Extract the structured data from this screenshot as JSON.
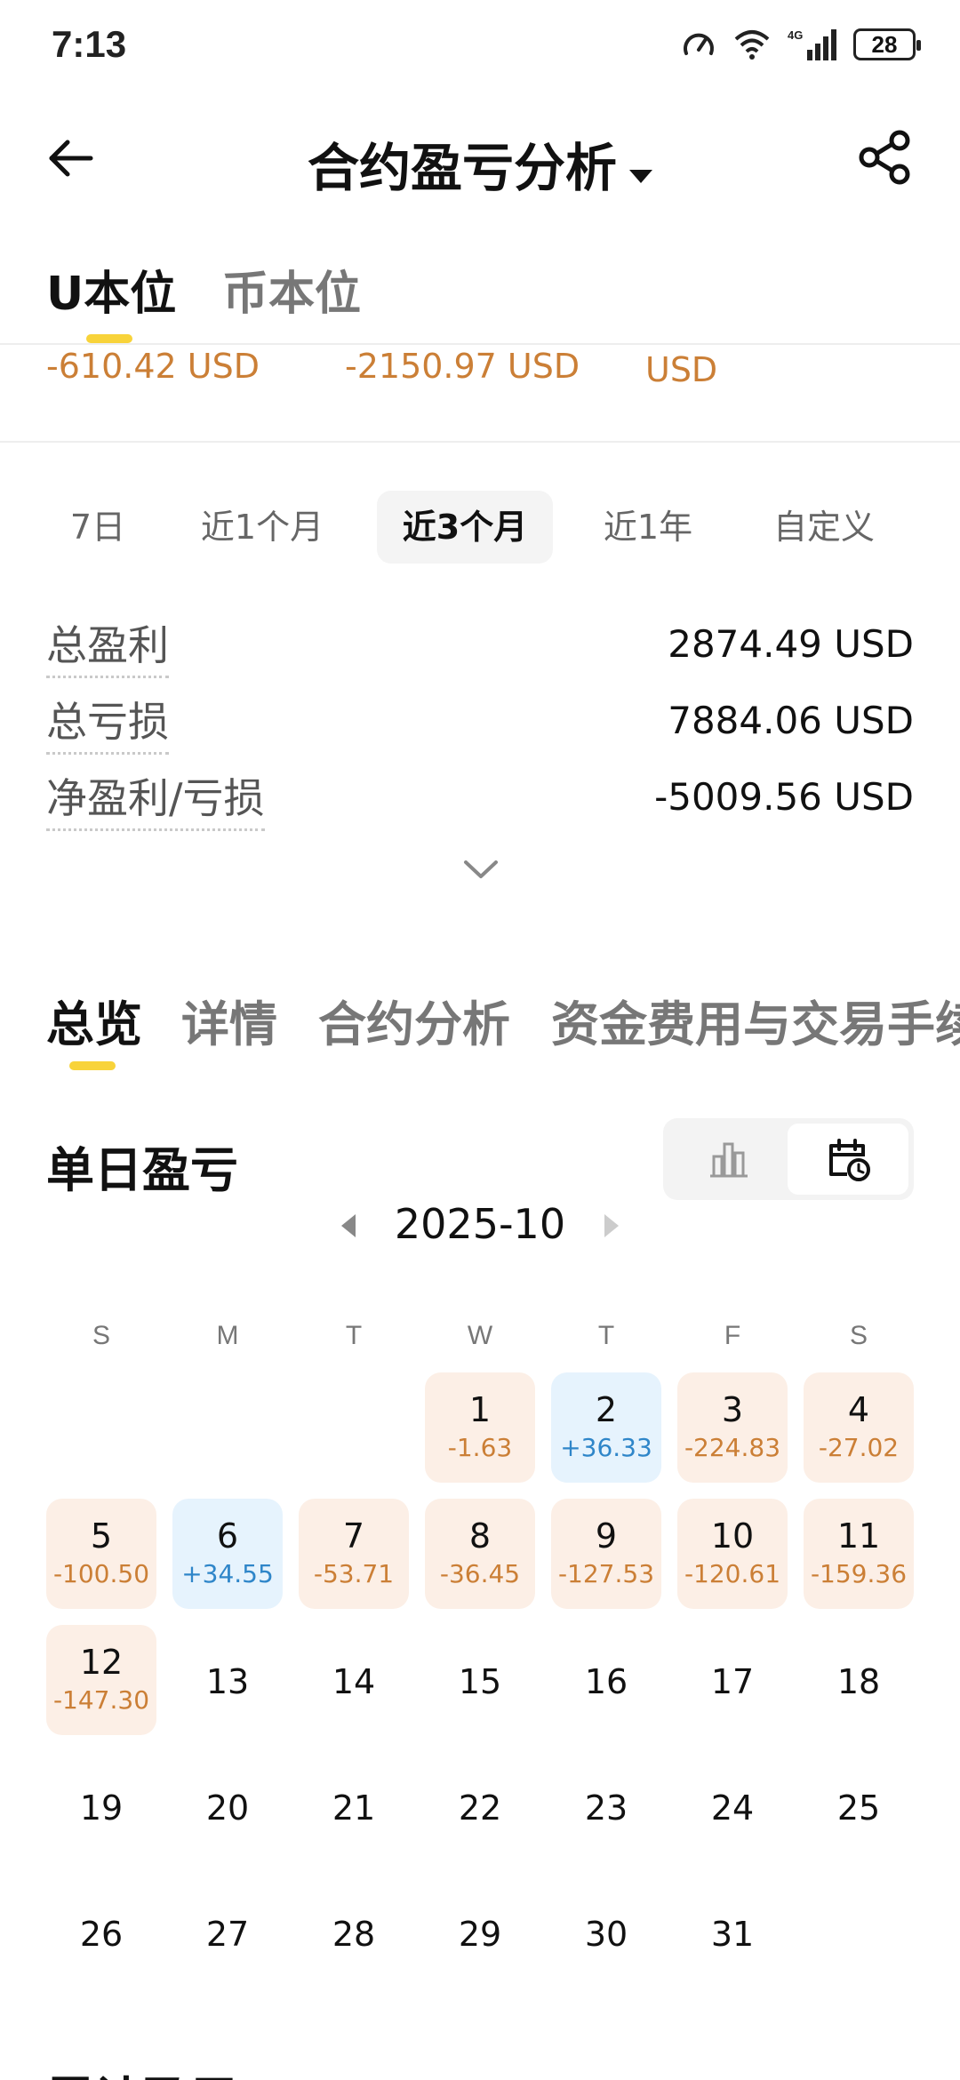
{
  "status_bar": {
    "time": "7:13",
    "battery": "28"
  },
  "header": {
    "title": "合约盈亏分析"
  },
  "unit_tabs": [
    {
      "label": "U本位"
    },
    {
      "label": "币本位"
    }
  ],
  "summary_values": [
    "-610.42 USD",
    "-2150.97 USD",
    "USD"
  ],
  "period_tabs": [
    "7日",
    "近1个月",
    "近3个月",
    "近1年",
    "自定义"
  ],
  "stats": [
    {
      "label": "总盈利",
      "value": "2874.49 USD"
    },
    {
      "label": "总亏损",
      "value": "7884.06 USD"
    },
    {
      "label": "净盈利/亏损",
      "value": "-5009.56 USD"
    }
  ],
  "section_tabs": [
    "总览",
    "详情",
    "合约分析",
    "资金费用与交易手续"
  ],
  "daily": {
    "title": "单日盈亏",
    "month": "2025-10",
    "weekdays": [
      "S",
      "M",
      "T",
      "W",
      "T",
      "F",
      "S"
    ],
    "days": [
      {
        "day": "1",
        "pnl": "-1.63",
        "type": "loss"
      },
      {
        "day": "2",
        "pnl": "+36.33",
        "type": "gain"
      },
      {
        "day": "3",
        "pnl": "-224.83",
        "type": "loss"
      },
      {
        "day": "4",
        "pnl": "-27.02",
        "type": "loss"
      },
      {
        "day": "5",
        "pnl": "-100.50",
        "type": "loss"
      },
      {
        "day": "6",
        "pnl": "+34.55",
        "type": "gain"
      },
      {
        "day": "7",
        "pnl": "-53.71",
        "type": "loss"
      },
      {
        "day": "8",
        "pnl": "-36.45",
        "type": "loss"
      },
      {
        "day": "9",
        "pnl": "-127.53",
        "type": "loss"
      },
      {
        "day": "10",
        "pnl": "-120.61",
        "type": "loss"
      },
      {
        "day": "11",
        "pnl": "-159.36",
        "type": "loss"
      },
      {
        "day": "12",
        "pnl": "-147.30",
        "type": "loss"
      },
      {
        "day": "13",
        "pnl": "",
        "type": "plain"
      },
      {
        "day": "14",
        "pnl": "",
        "type": "plain"
      },
      {
        "day": "15",
        "pnl": "",
        "type": "plain"
      },
      {
        "day": "16",
        "pnl": "",
        "type": "plain"
      },
      {
        "day": "17",
        "pnl": "",
        "type": "plain"
      },
      {
        "day": "18",
        "pnl": "",
        "type": "plain"
      },
      {
        "day": "19",
        "pnl": "",
        "type": "plain"
      },
      {
        "day": "20",
        "pnl": "",
        "type": "plain"
      },
      {
        "day": "21",
        "pnl": "",
        "type": "plain"
      },
      {
        "day": "22",
        "pnl": "",
        "type": "plain"
      },
      {
        "day": "23",
        "pnl": "",
        "type": "plain"
      },
      {
        "day": "24",
        "pnl": "",
        "type": "plain"
      },
      {
        "day": "25",
        "pnl": "",
        "type": "plain"
      },
      {
        "day": "26",
        "pnl": "",
        "type": "plain"
      },
      {
        "day": "27",
        "pnl": "",
        "type": "plain"
      },
      {
        "day": "28",
        "pnl": "",
        "type": "plain"
      },
      {
        "day": "29",
        "pnl": "",
        "type": "plain"
      },
      {
        "day": "30",
        "pnl": "",
        "type": "plain"
      },
      {
        "day": "31",
        "pnl": "",
        "type": "plain"
      }
    ]
  },
  "bottom_section": {
    "title": "累计盈亏"
  },
  "colors": {
    "accent": "#F8D33A",
    "loss": "#CB7F36",
    "gain": "#2F86C9",
    "loss_bg": "#FCEFE6",
    "gain_bg": "#E6F3FD"
  }
}
